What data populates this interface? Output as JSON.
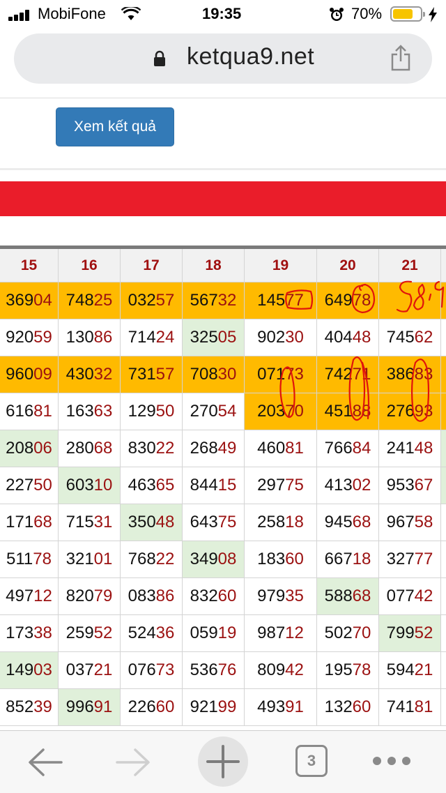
{
  "status_bar": {
    "carrier": "MobiFone",
    "time": "19:35",
    "battery_percent": "70%",
    "battery_level": 0.7
  },
  "address_bar": {
    "url": "ketqua9.net"
  },
  "page": {
    "view_result_button": "Xem kết quả",
    "banner_color": "#ea1d2a"
  },
  "colors": {
    "highlight_orange": "#ffba00",
    "highlight_green": "#e0f0da",
    "number_tail": "#9b1111"
  },
  "table": {
    "columns": [
      "15",
      "16",
      "17",
      "18",
      "19",
      "20",
      "21"
    ],
    "rows": [
      {
        "cells": [
          {
            "head": "369",
            "tail": "04",
            "bg": "orange"
          },
          {
            "head": "748",
            "tail": "25",
            "bg": "orange"
          },
          {
            "head": "032",
            "tail": "57",
            "bg": "orange"
          },
          {
            "head": "567",
            "tail": "32",
            "bg": "orange"
          },
          {
            "head": "145",
            "tail": "77",
            "bg": "orange"
          },
          {
            "head": "649",
            "tail": "78",
            "bg": "orange"
          },
          {
            "head": "",
            "tail": "",
            "bg": "orange"
          }
        ]
      },
      {
        "cells": [
          {
            "head": "920",
            "tail": "59"
          },
          {
            "head": "130",
            "tail": "86"
          },
          {
            "head": "714",
            "tail": "24"
          },
          {
            "head": "325",
            "tail": "05",
            "bg": "green"
          },
          {
            "head": "902",
            "tail": "30"
          },
          {
            "head": "404",
            "tail": "48"
          },
          {
            "head": "745",
            "tail": "62"
          }
        ]
      },
      {
        "cells": [
          {
            "head": "960",
            "tail": "09",
            "bg": "orange"
          },
          {
            "head": "430",
            "tail": "32",
            "bg": "orange"
          },
          {
            "head": "731",
            "tail": "57",
            "bg": "orange"
          },
          {
            "head": "708",
            "tail": "30",
            "bg": "orange"
          },
          {
            "head": "071",
            "tail": "73",
            "bg": "orange"
          },
          {
            "head": "742",
            "tail": "71",
            "bg": "orange"
          },
          {
            "head": "386",
            "tail": "83",
            "bg": "orange"
          }
        ]
      },
      {
        "cells": [
          {
            "head": "616",
            "tail": "81"
          },
          {
            "head": "163",
            "tail": "63"
          },
          {
            "head": "129",
            "tail": "50"
          },
          {
            "head": "270",
            "tail": "54"
          },
          {
            "head": "203",
            "tail": "70",
            "bg": "orange"
          },
          {
            "head": "451",
            "tail": "88",
            "bg": "orange"
          },
          {
            "head": "276",
            "tail": "93",
            "bg": "orange"
          }
        ]
      },
      {
        "cells": [
          {
            "head": "208",
            "tail": "06",
            "bg": "green"
          },
          {
            "head": "280",
            "tail": "68"
          },
          {
            "head": "830",
            "tail": "22"
          },
          {
            "head": "268",
            "tail": "49"
          },
          {
            "head": "460",
            "tail": "81"
          },
          {
            "head": "766",
            "tail": "84"
          },
          {
            "head": "241",
            "tail": "48"
          }
        ]
      },
      {
        "cells": [
          {
            "head": "227",
            "tail": "50"
          },
          {
            "head": "603",
            "tail": "10",
            "bg": "green"
          },
          {
            "head": "463",
            "tail": "65"
          },
          {
            "head": "844",
            "tail": "15"
          },
          {
            "head": "297",
            "tail": "75"
          },
          {
            "head": "413",
            "tail": "02"
          },
          {
            "head": "953",
            "tail": "67"
          }
        ]
      },
      {
        "cells": [
          {
            "head": "171",
            "tail": "68"
          },
          {
            "head": "715",
            "tail": "31"
          },
          {
            "head": "350",
            "tail": "48",
            "bg": "green"
          },
          {
            "head": "643",
            "tail": "75"
          },
          {
            "head": "258",
            "tail": "18"
          },
          {
            "head": "945",
            "tail": "68"
          },
          {
            "head": "967",
            "tail": "58"
          }
        ]
      },
      {
        "cells": [
          {
            "head": "511",
            "tail": "78"
          },
          {
            "head": "321",
            "tail": "01"
          },
          {
            "head": "768",
            "tail": "22"
          },
          {
            "head": "349",
            "tail": "08",
            "bg": "green"
          },
          {
            "head": "183",
            "tail": "60"
          },
          {
            "head": "667",
            "tail": "18"
          },
          {
            "head": "327",
            "tail": "77"
          }
        ]
      },
      {
        "cells": [
          {
            "head": "497",
            "tail": "12"
          },
          {
            "head": "820",
            "tail": "79"
          },
          {
            "head": "083",
            "tail": "86"
          },
          {
            "head": "832",
            "tail": "60"
          },
          {
            "head": "979",
            "tail": "35"
          },
          {
            "head": "588",
            "tail": "68",
            "bg": "green"
          },
          {
            "head": "077",
            "tail": "42"
          }
        ]
      },
      {
        "cells": [
          {
            "head": "173",
            "tail": "38"
          },
          {
            "head": "259",
            "tail": "52"
          },
          {
            "head": "524",
            "tail": "36"
          },
          {
            "head": "059",
            "tail": "19"
          },
          {
            "head": "987",
            "tail": "12"
          },
          {
            "head": "502",
            "tail": "70"
          },
          {
            "head": "799",
            "tail": "52",
            "bg": "green"
          }
        ]
      },
      {
        "cells": [
          {
            "head": "149",
            "tail": "03",
            "bg": "green"
          },
          {
            "head": "037",
            "tail": "21"
          },
          {
            "head": "076",
            "tail": "73"
          },
          {
            "head": "536",
            "tail": "76"
          },
          {
            "head": "809",
            "tail": "42"
          },
          {
            "head": "195",
            "tail": "78"
          },
          {
            "head": "594",
            "tail": "21"
          }
        ]
      },
      {
        "cells": [
          {
            "head": "852",
            "tail": "39"
          },
          {
            "head": "996",
            "tail": "91",
            "bg": "green"
          },
          {
            "head": "226",
            "tail": "60"
          },
          {
            "head": "921",
            "tail": "99"
          },
          {
            "head": "493",
            "tail": "91"
          },
          {
            "head": "132",
            "tail": "60"
          },
          {
            "head": "741",
            "tail": "81"
          }
        ]
      }
    ]
  },
  "toolbar": {
    "tab_count": "3"
  }
}
